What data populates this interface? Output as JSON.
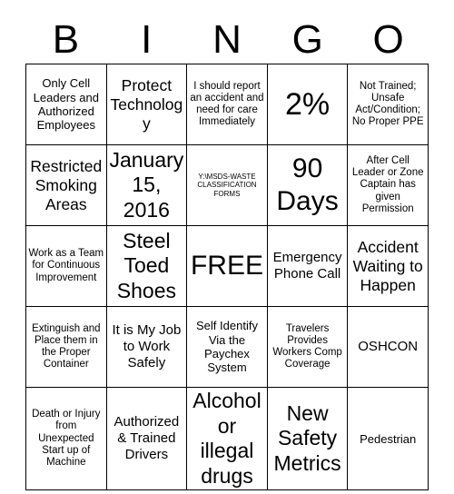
{
  "header": {
    "letters": [
      "B",
      "I",
      "N",
      "G",
      "O"
    ]
  },
  "grid": {
    "rows": [
      [
        {
          "text": "Only Cell Leaders and Authorized Employees",
          "size": "fs-s"
        },
        {
          "text": "Protect Technology",
          "size": "fs-l"
        },
        {
          "text": "I should report an accident and need for care Immediately",
          "size": "fs-xs"
        },
        {
          "text": "2%",
          "size": "fs-huge"
        },
        {
          "text": "Not Trained; Unsafe Act/Condition; No Proper PPE",
          "size": "fs-xs"
        }
      ],
      [
        {
          "text": "Restricted Smoking Areas",
          "size": "fs-l"
        },
        {
          "text": "January 15, 2016",
          "size": "fs-xl"
        },
        {
          "text": "Y:\\MSDS-WASTE CLASSIFICATION FORMS",
          "size": "fs-xxs"
        },
        {
          "text": "90 Days",
          "size": "fs-xxl"
        },
        {
          "text": "After Cell Leader or Zone Captain has given Permission",
          "size": "fs-xs"
        }
      ],
      [
        {
          "text": "Work as a Team for Continuous Improvement",
          "size": "fs-xs"
        },
        {
          "text": "Steel Toed Shoes",
          "size": "fs-xl"
        },
        {
          "text": "FREE",
          "size": "fs-xxl"
        },
        {
          "text": "Emergency Phone Call",
          "size": "fs-m"
        },
        {
          "text": "Accident Waiting to Happen",
          "size": "fs-l"
        }
      ],
      [
        {
          "text": "Extinguish and Place them in the Proper Container",
          "size": "fs-xs"
        },
        {
          "text": "It is My Job to Work Safely",
          "size": "fs-m"
        },
        {
          "text": "Self Identify Via the Paychex System",
          "size": "fs-s"
        },
        {
          "text": "Travelers Provides Workers Comp Coverage",
          "size": "fs-xs"
        },
        {
          "text": "OSHCON",
          "size": "fs-m"
        }
      ],
      [
        {
          "text": "Death or Injury from Unexpected Start up of Machine",
          "size": "fs-xs"
        },
        {
          "text": "Authorized & Trained Drivers",
          "size": "fs-m"
        },
        {
          "text": "Alcohol or illegal drugs",
          "size": "fs-xl"
        },
        {
          "text": "New Safety Metrics",
          "size": "fs-xl"
        },
        {
          "text": "Pedestrian",
          "size": "fs-s"
        }
      ]
    ]
  },
  "colors": {
    "background": "#ffffff",
    "text": "#000000",
    "border": "#000000"
  }
}
